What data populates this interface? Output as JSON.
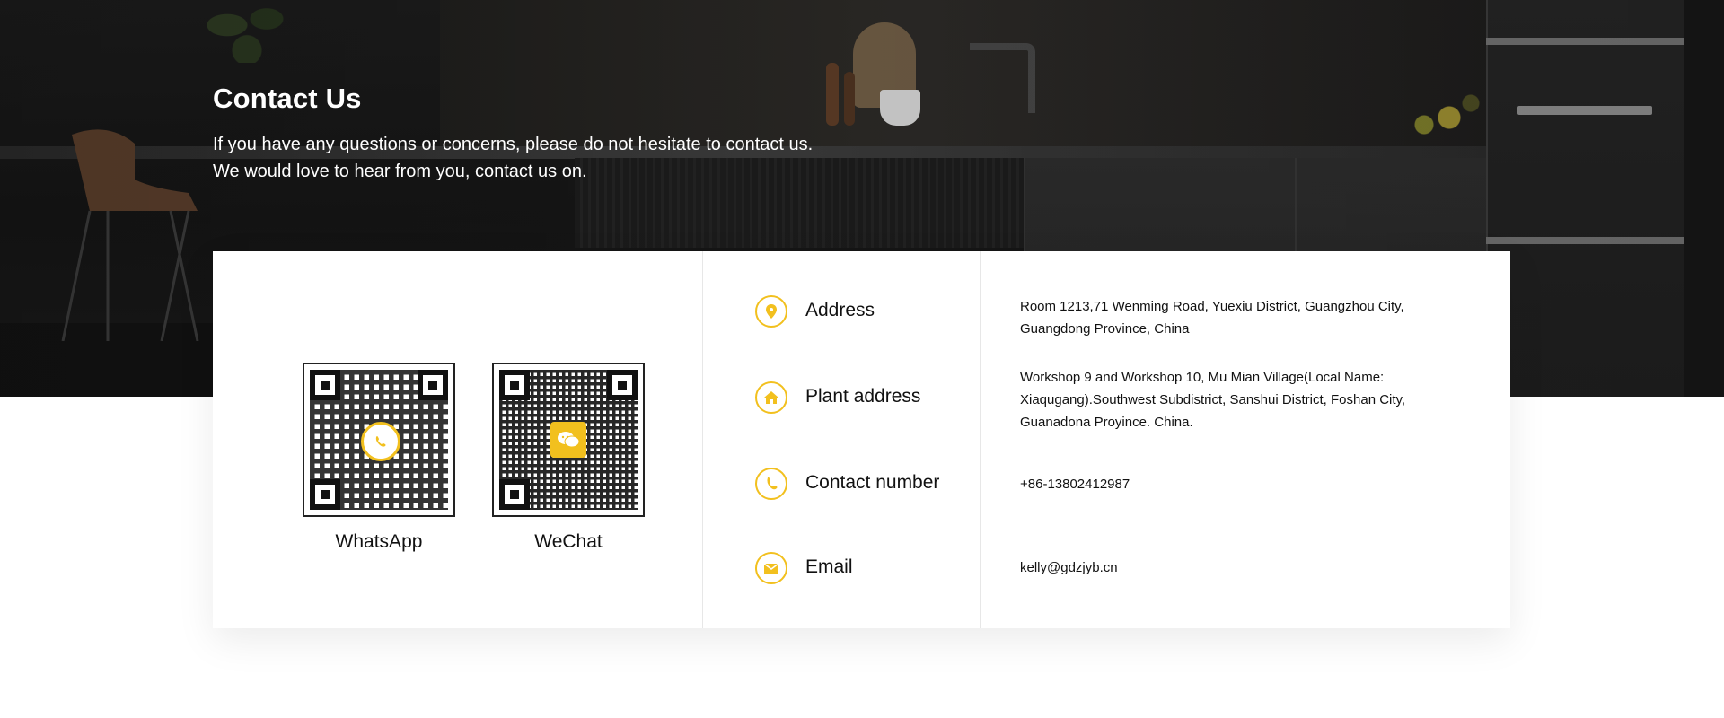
{
  "hero": {
    "title": "Contact Us",
    "line1": "If you have any questions or concerns, please do not hesitate to contact us.",
    "line2": "We would love to hear from you, contact us on."
  },
  "qr_codes": [
    {
      "label": "WhatsApp",
      "icon": "whatsapp-icon"
    },
    {
      "label": "WeChat",
      "icon": "wechat-icon"
    }
  ],
  "contacts": [
    {
      "label": "Address",
      "icon": "location-pin-icon",
      "value": "Room 1213,71 Wenming Road, Yuexiu District, Guangzhou City, Guangdong Province, China"
    },
    {
      "label": "Plant address",
      "icon": "home-icon",
      "value": "Workshop 9 and Workshop 10, Mu Mian Village(Local Name: Xiaqugang).Southwest Subdistrict, Sanshui District, Foshan City, Guanadona Proyince. China."
    },
    {
      "label": "Contact number",
      "icon": "phone-icon",
      "value": "+86-13802412987"
    },
    {
      "label": "Email",
      "icon": "mail-icon",
      "value": "kelly@gdzjyb.cn"
    }
  ],
  "colors": {
    "accent": "#f2c01e",
    "text": "#111111",
    "hero_text": "#ffffff"
  }
}
